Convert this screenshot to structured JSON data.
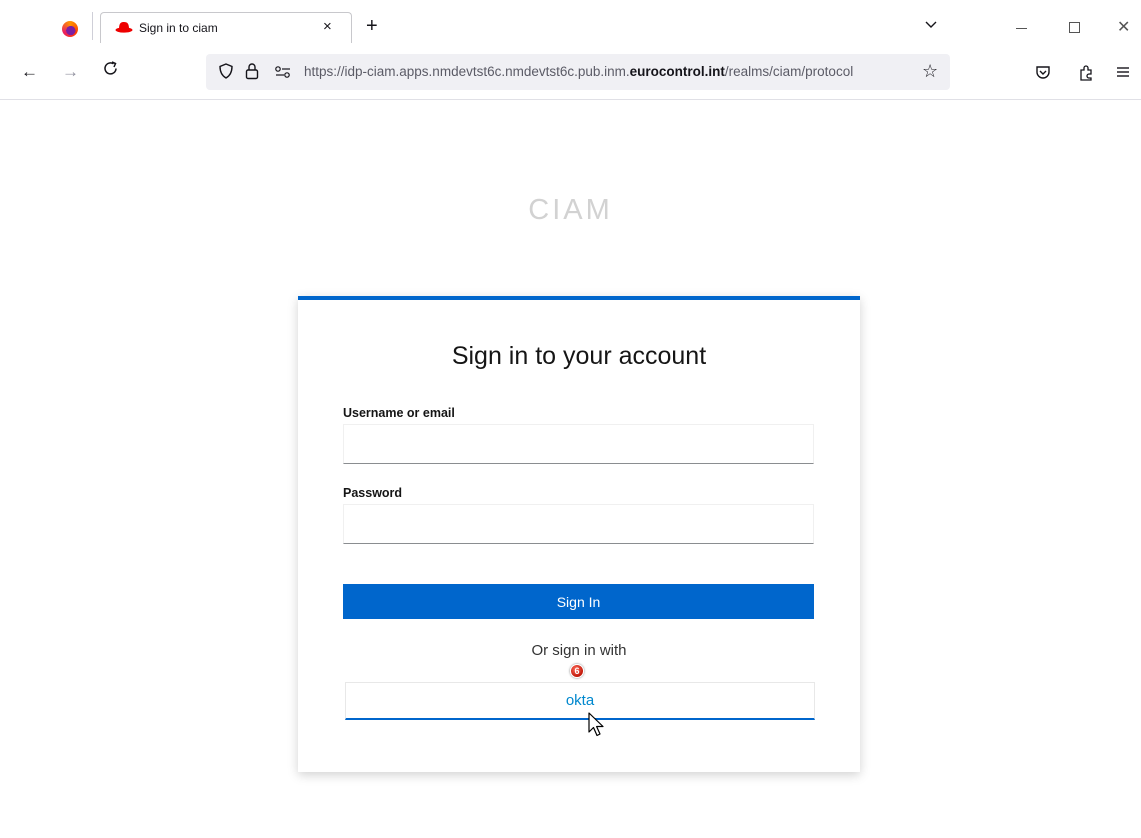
{
  "browser": {
    "tab": {
      "title": "Sign in to ciam",
      "close_glyph": "×"
    },
    "new_tab_glyph": "+",
    "url": {
      "host_prefix": "https://idp-ciam.apps.nmdevtst6c.nmdevtst6c.pub.inm.",
      "domain": "eurocontrol.int",
      "path": "/realms/ciam/protocol"
    },
    "icons": [
      "firefox-icon",
      "redhat-icon",
      "shield-icon",
      "lock-icon",
      "permissions-icon",
      "star-icon",
      "pocket-icon",
      "extensions-icon",
      "menu-icon"
    ]
  },
  "page": {
    "brand": "CIAM",
    "form": {
      "title": "Sign in to your account",
      "username_label": "Username or email",
      "username_value": "",
      "password_label": "Password",
      "password_value": "",
      "sign_in_label": "Sign In",
      "or_text": "Or sign in with",
      "provider_label": "okta"
    },
    "step_badge": "6"
  },
  "colors": {
    "accent": "#0066cc",
    "link": "#0088ce",
    "brand_text": "#d2d2d2"
  }
}
